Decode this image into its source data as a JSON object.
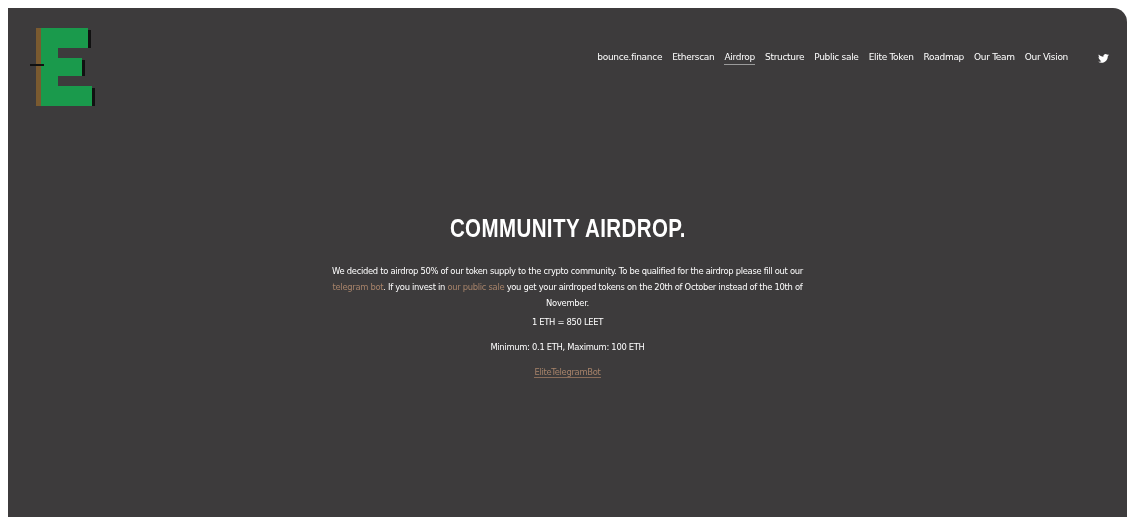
{
  "nav": {
    "items": [
      {
        "label": "bounce.finance",
        "selected": false
      },
      {
        "label": "Etherscan",
        "selected": false
      },
      {
        "label": "Airdrop",
        "selected": true
      },
      {
        "label": "Structure",
        "selected": false
      },
      {
        "label": "Public sale",
        "selected": false
      },
      {
        "label": "Elite Token",
        "selected": false
      },
      {
        "label": "Roadmap",
        "selected": false
      },
      {
        "label": "Our Team",
        "selected": false
      },
      {
        "label": "Our Vision",
        "selected": false
      }
    ]
  },
  "hero": {
    "title": "COMMUNITY AIRDROP.",
    "intro": [
      {
        "kind": "text",
        "text": "We decided to airdrop 50% of our token supply to the crypto community. To be qualified for the airdrop please fill out our "
      },
      {
        "kind": "link",
        "text": "telegram bot"
      },
      {
        "kind": "text",
        "text": ". If you invest in "
      },
      {
        "kind": "link",
        "text": "our public sale"
      },
      {
        "kind": "text",
        "text": " you get your airdroped tokens on the 20th of October instead of the 10th of November."
      }
    ],
    "rate": "1 ETH = 850 LEET",
    "limits": "Minimum: 0.1 ETH,  Maximum: 100 ETH",
    "bot_link": "EliteTelegramBot"
  }
}
